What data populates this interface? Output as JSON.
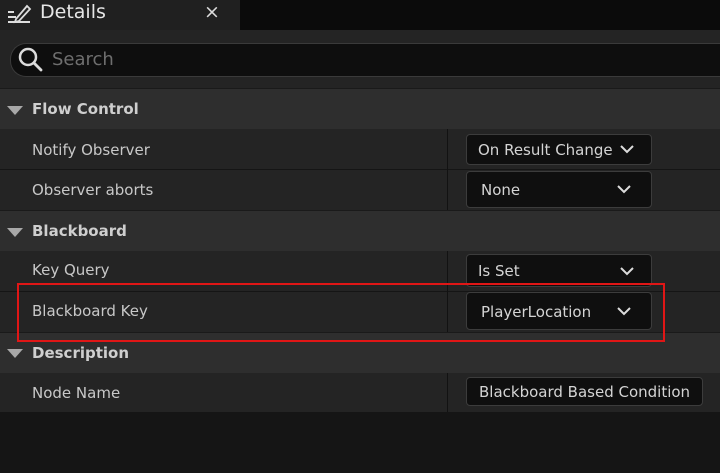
{
  "tab": {
    "title": "Details",
    "close_glyph": "×",
    "icon": "edit-details-icon"
  },
  "search": {
    "placeholder": "Search",
    "value": ""
  },
  "categories": [
    {
      "label": "Flow Control",
      "rows": [
        {
          "name": "Notify Observer",
          "value": "On Result Change",
          "control": "dropdown"
        },
        {
          "name": "Observer aborts",
          "value": "None",
          "control": "dropdown"
        }
      ]
    },
    {
      "label": "Blackboard",
      "rows": [
        {
          "name": "Key Query",
          "value": "Is Set",
          "control": "dropdown"
        },
        {
          "name": "Blackboard Key",
          "value": "PlayerLocation",
          "control": "dropdown"
        }
      ]
    },
    {
      "label": "Description",
      "rows": [
        {
          "name": "Node Name",
          "value": "Blackboard Based Condition",
          "control": "text"
        }
      ]
    }
  ],
  "colors": {
    "background": "#151515",
    "category": "#2e2e2e",
    "row": "#242424",
    "highlight": "#e01616"
  }
}
